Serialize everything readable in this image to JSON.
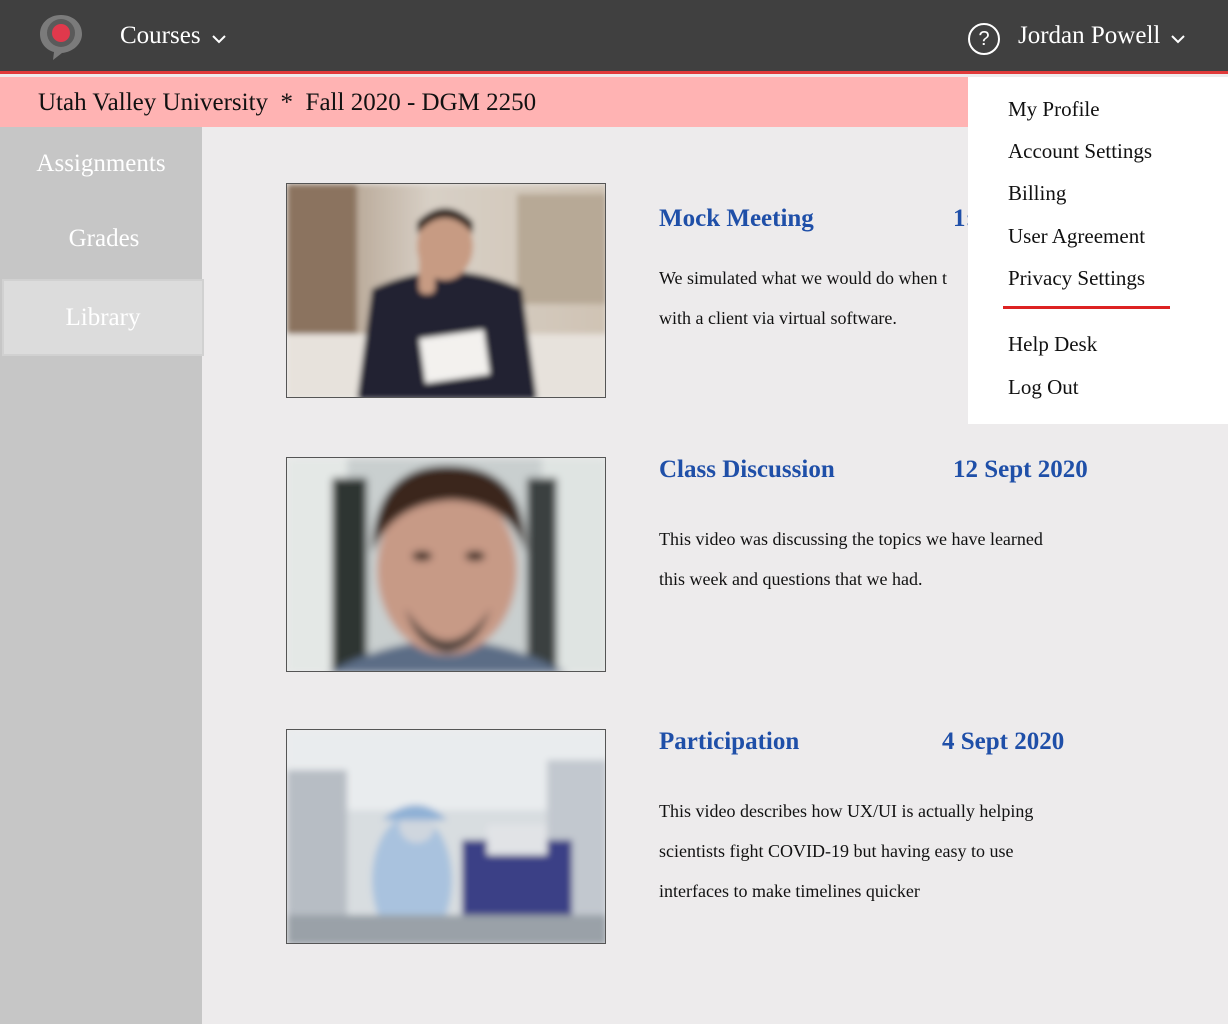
{
  "header": {
    "courses_label": "Courses",
    "help_symbol": "?",
    "user_name": "Jordan Powell"
  },
  "course_bar": {
    "text": "Utah Valley University  *  Fall 2020 - DGM 2250"
  },
  "sidebar": {
    "items": [
      {
        "label": "Assignments"
      },
      {
        "label": "Grades"
      },
      {
        "label": "Library",
        "active": true
      }
    ]
  },
  "library": {
    "items": [
      {
        "title": "Mock Meeting",
        "date": "1:",
        "description_lines": [
          "We simulated what we would do when t",
          "with a client via virtual software."
        ]
      },
      {
        "title": "Class Discussion",
        "date": "12 Sept 2020",
        "description_lines": [
          "This video was discussing the topics we have learned",
          "this week and questions that we had."
        ]
      },
      {
        "title": "Participation",
        "date": "4 Sept 2020",
        "description_lines": [
          "This video describes how UX/UI is actually helping",
          "scientists fight COVID-19 but having easy to use",
          "interfaces to make timelines quicker"
        ]
      }
    ]
  },
  "user_menu": {
    "items": [
      {
        "label": "My Profile"
      },
      {
        "label": "Account Settings"
      },
      {
        "label": "Billing"
      },
      {
        "label": "User Agreement"
      },
      {
        "label": "Privacy Settings"
      },
      {
        "label": "Help Desk"
      },
      {
        "label": "Log Out"
      }
    ]
  },
  "colors": {
    "topbar": "#404040",
    "accent_red": "#e03a3a",
    "course_bar": "#ffb3b3",
    "link_blue": "#1f4fa8",
    "sidebar": "#c6c6c6",
    "content_bg": "#edebec"
  },
  "icons": {
    "logo": "speech-bubble-record-icon",
    "courses_chevron": "chevron-down-icon",
    "help": "question-circle-icon",
    "user_chevron": "chevron-down-icon"
  }
}
